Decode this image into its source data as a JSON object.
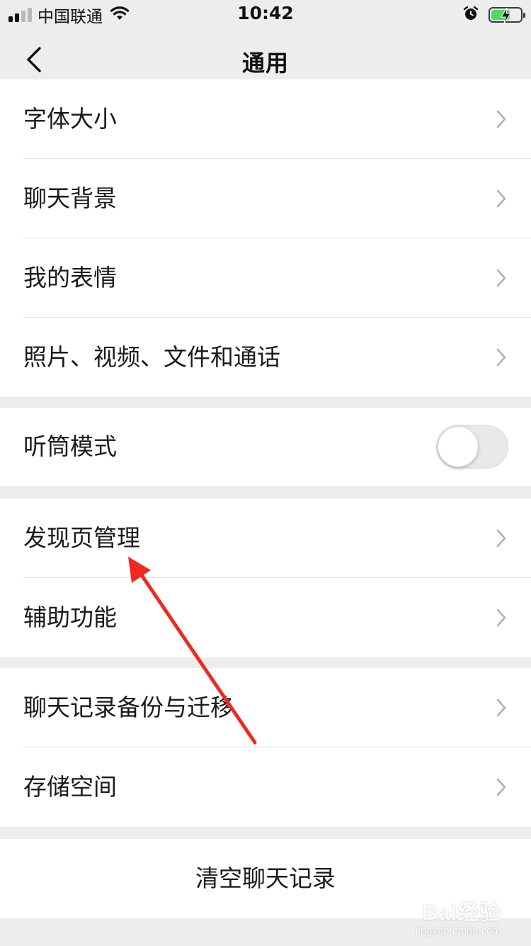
{
  "status_bar": {
    "carrier": "中国联通",
    "time": "10:42",
    "signal_bars_active": 2,
    "signal_bars_total": 4,
    "battery_level": 0.65,
    "battery_charging": true
  },
  "nav": {
    "title": "通用",
    "back_icon": "chevron-left-icon"
  },
  "groups": [
    {
      "items": [
        {
          "label": "字体大小",
          "type": "link"
        },
        {
          "label": "聊天背景",
          "type": "link"
        },
        {
          "label": "我的表情",
          "type": "link"
        },
        {
          "label": "照片、视频、文件和通话",
          "type": "link"
        }
      ]
    },
    {
      "items": [
        {
          "label": "听筒模式",
          "type": "toggle",
          "value": false
        }
      ]
    },
    {
      "items": [
        {
          "label": "发现页管理",
          "type": "link"
        },
        {
          "label": "辅助功能",
          "type": "link"
        }
      ]
    },
    {
      "items": [
        {
          "label": "聊天记录备份与迁移",
          "type": "link"
        },
        {
          "label": "存储空间",
          "type": "link"
        }
      ]
    }
  ],
  "clear_action": {
    "label": "清空聊天记录"
  },
  "watermark": {
    "brand": "Bai经验",
    "url": "jingyan.baidu.com"
  },
  "colors": {
    "background": "#ededed",
    "cell": "#ffffff",
    "separator": "#e5e5e5",
    "annotation_arrow": "#f0281e",
    "battery": "#4cd964"
  }
}
